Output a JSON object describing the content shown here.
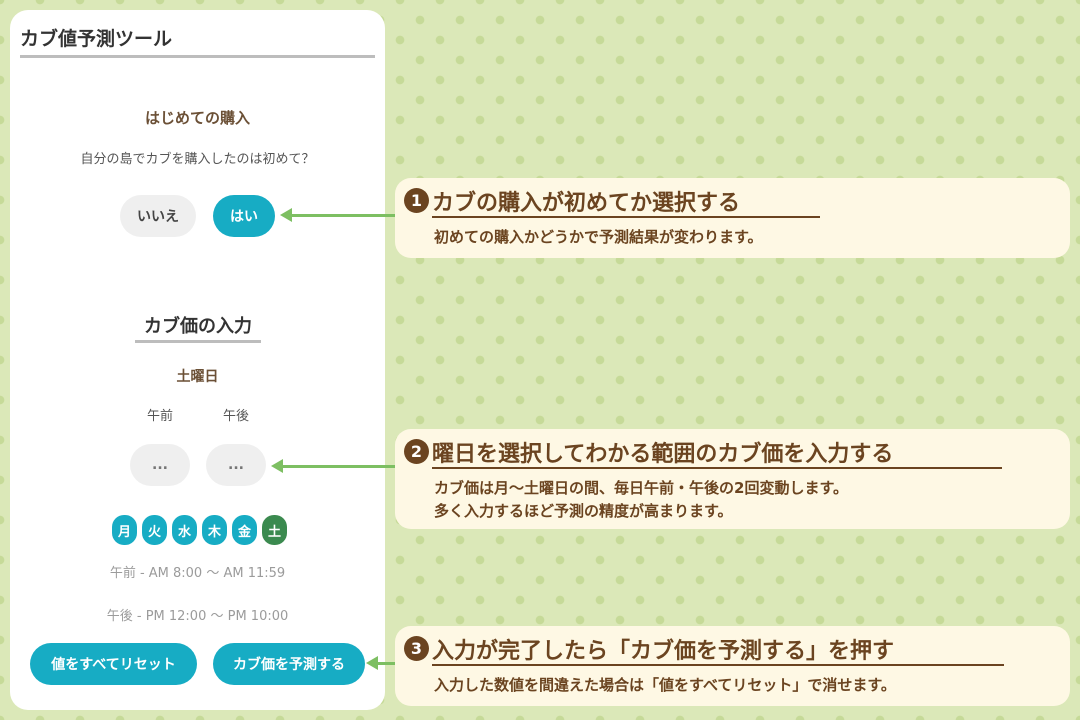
{
  "panel": {
    "title": "カブ値予測ツール",
    "first_purchase": {
      "heading": "はじめての購入",
      "question": "自分の島でカブを購入したのは初めて？",
      "no_label": "いいえ",
      "yes_label": "はい",
      "selected": "はい"
    },
    "price_input": {
      "heading": "カブ価の入力",
      "day_label": "土曜日",
      "am_label": "午前",
      "pm_label": "午後",
      "am_value": "...",
      "pm_value": "...",
      "days": [
        "月",
        "火",
        "水",
        "木",
        "金",
        "土"
      ],
      "selected_day": "土",
      "am_hours": "午前 - AM 8:00 〜 AM 11:59",
      "pm_hours": "午後 - PM 12:00 〜 PM 10:00"
    },
    "reset_label": "値をすべてリセット",
    "predict_label": "カブ価を予測する"
  },
  "callouts": [
    {
      "number": "1",
      "title": "カブの購入が初めてか選択する",
      "lines": [
        "初めての購入かどうかで予測結果が変わります。"
      ]
    },
    {
      "number": "2",
      "title": "曜日を選択してわかる範囲のカブ価を入力する",
      "lines": [
        "カブ価は月〜土曜日の間、毎日午前・午後の2回変動します。",
        "多く入力するほど予測の精度が高まります。"
      ]
    },
    {
      "number": "3",
      "title": "入力が完了したら「カブ価を予測する」を押す",
      "lines": [
        "入力した数値を間違えた場合は「値をすべてリセット」で消せます。"
      ]
    }
  ],
  "colors": {
    "accent": "#17acc4",
    "selected_day": "#3b8a4f",
    "callout_text": "#6b4420",
    "arrow": "#7dbf62",
    "background": "#dbe8b8"
  }
}
